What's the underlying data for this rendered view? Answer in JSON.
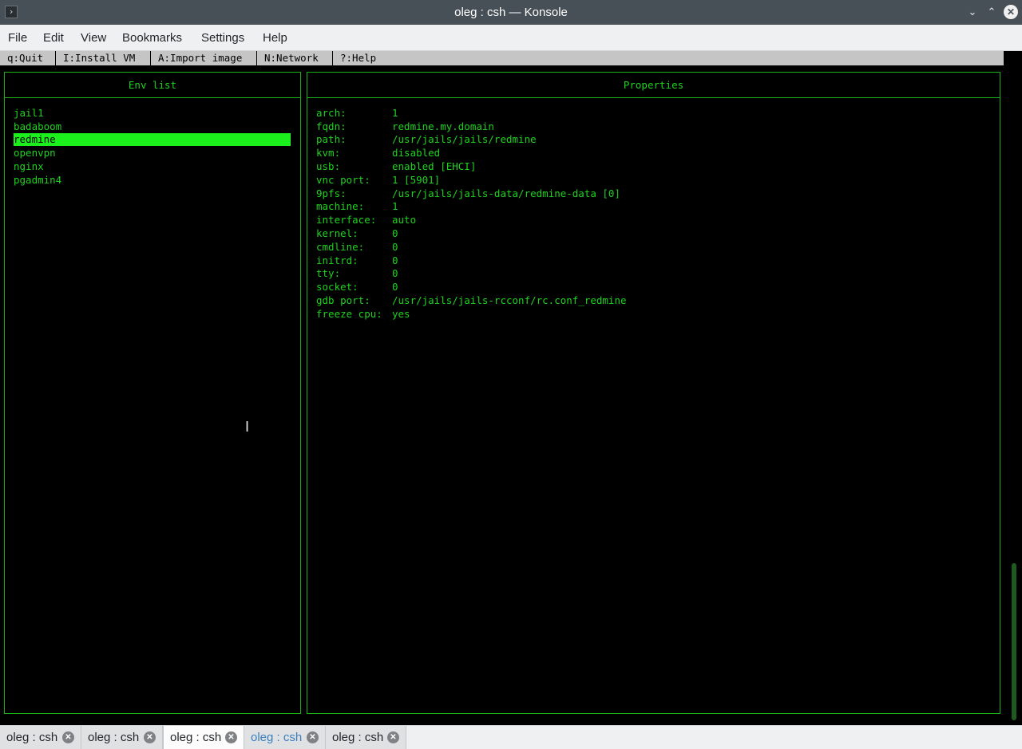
{
  "window": {
    "title": "oleg : csh — Konsole",
    "app_icon": "terminal-icon",
    "buttons": [
      "minimize-icon",
      "maximize-icon",
      "close-icon"
    ]
  },
  "menubar": {
    "items": [
      "File",
      "Edit",
      "View",
      "Bookmarks",
      "Settings",
      "Help"
    ]
  },
  "hotkeys": [
    "q:Quit",
    "I:Install VM",
    "A:Import image",
    "N:Network",
    "?:Help"
  ],
  "env_panel": {
    "title": "Env list",
    "items": [
      "jail1",
      "badaboom",
      "redmine",
      "openvpn",
      "nginx",
      "pgadmin4"
    ],
    "selected": "redmine"
  },
  "props_panel": {
    "title": "Properties",
    "rows": [
      {
        "key": "arch:",
        "value": "1"
      },
      {
        "key": "fqdn:",
        "value": "redmine.my.domain"
      },
      {
        "key": "path:",
        "value": "/usr/jails/jails/redmine"
      },
      {
        "key": "kvm:",
        "value": "disabled"
      },
      {
        "key": "usb:",
        "value": "enabled [EHCI]"
      },
      {
        "key": "vnc port:",
        "value": "1 [5901]"
      },
      {
        "key": "9pfs:",
        "value": "/usr/jails/jails-data/redmine-data [0]"
      },
      {
        "key": "machine:",
        "value": "1"
      },
      {
        "key": "interface:",
        "value": "auto"
      },
      {
        "key": "kernel:",
        "value": "0"
      },
      {
        "key": "cmdline:",
        "value": "0"
      },
      {
        "key": "initrd:",
        "value": "0"
      },
      {
        "key": "tty:",
        "value": "0"
      },
      {
        "key": "socket:",
        "value": "0"
      },
      {
        "key": "gdb port:",
        "value": "/usr/jails/jails-rcconf/rc.conf_redmine"
      },
      {
        "key": "freeze cpu:",
        "value": "yes"
      }
    ]
  },
  "tabs": [
    {
      "label": "oleg : csh",
      "active": false,
      "activity": false
    },
    {
      "label": "oleg : csh",
      "active": false,
      "activity": false
    },
    {
      "label": "oleg : csh",
      "active": true,
      "activity": false
    },
    {
      "label": "oleg : csh",
      "active": false,
      "activity": true
    },
    {
      "label": "oleg : csh",
      "active": false,
      "activity": false
    }
  ],
  "colors": {
    "terminal_bg": "#000000",
    "terminal_fg": "#1ed21e",
    "selection_bg": "#1cf01c",
    "border": "#18b218",
    "titlebar": "#475057"
  }
}
